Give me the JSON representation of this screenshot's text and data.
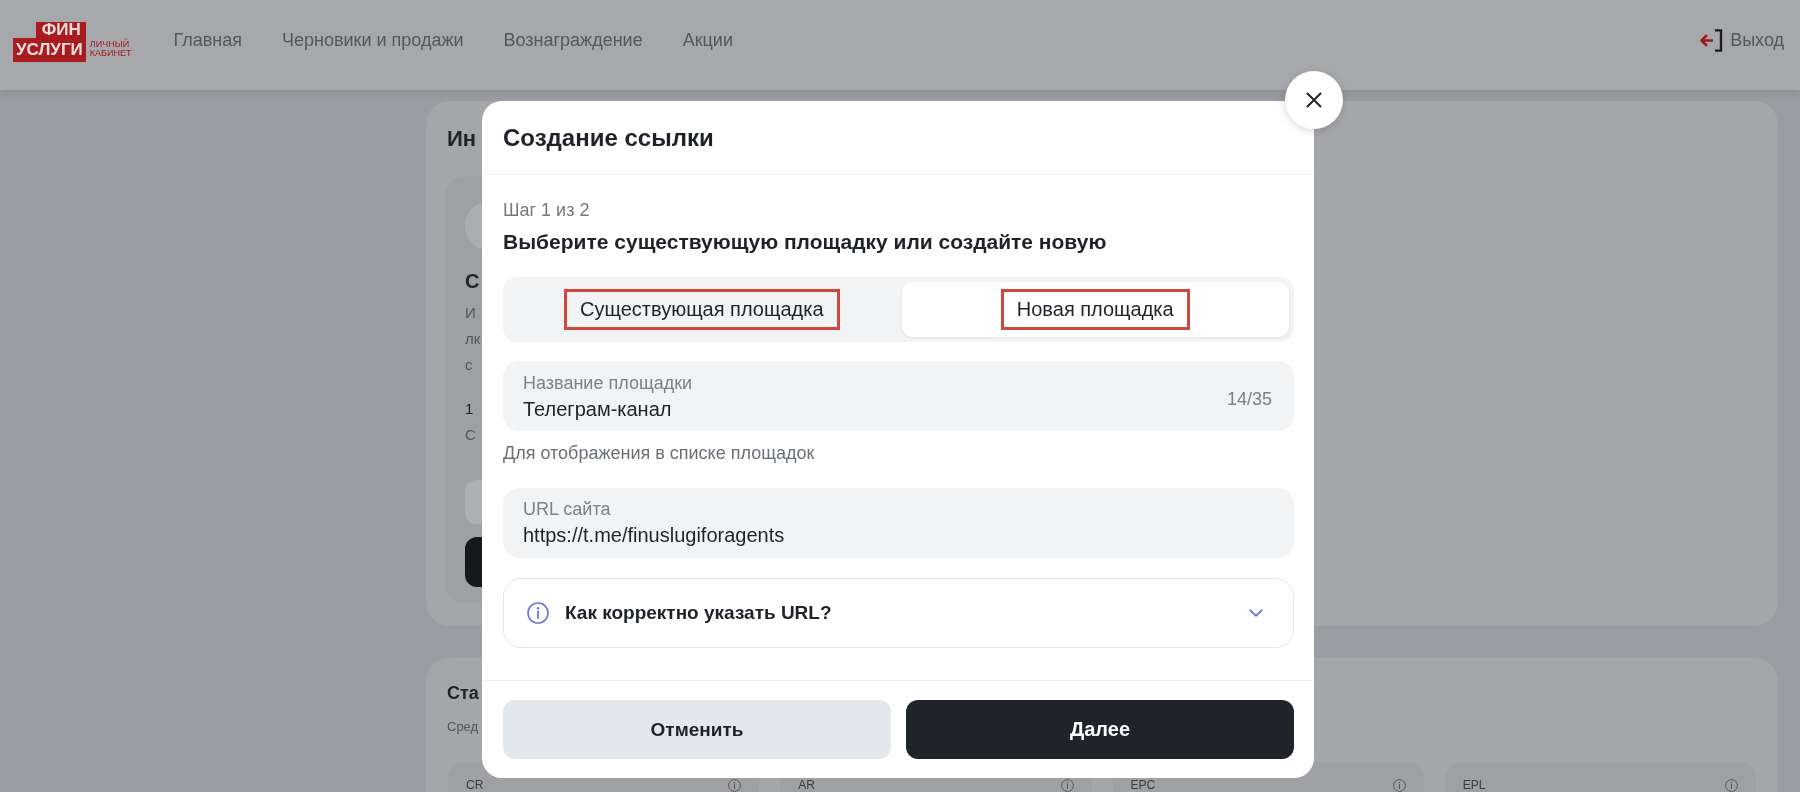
{
  "header": {
    "logo": {
      "top_word": "ФИН",
      "bottom_word": "УСЛУГИ",
      "caption": "ЛИЧНЫЙ КАБИНЕТ"
    },
    "nav": [
      "Главная",
      "Черновики и продажи",
      "Вознаграждение",
      "Акции"
    ],
    "logout": "Выход"
  },
  "page": {
    "info_card": {
      "title": "Ин",
      "subtitle": "С",
      "lines": [
        "И",
        "лк",
        "с"
      ],
      "count": "1",
      "count_caption": "С"
    },
    "stats_card": {
      "title": "Ста",
      "subtitle": "Сред",
      "metrics": [
        {
          "label": "CR"
        },
        {
          "label": "AR"
        },
        {
          "label": "EPC"
        },
        {
          "label": "EPL"
        }
      ]
    }
  },
  "dialog": {
    "title": "Создание ссылки",
    "step": "Шаг 1 из 2",
    "heading": "Выберите существующую площадку или создайте новую",
    "tabs": [
      {
        "label": "Существующая площадка",
        "selected": false,
        "highlighted": true
      },
      {
        "label": "Новая площадка",
        "selected": true,
        "highlighted": true
      }
    ],
    "fields": [
      {
        "label": "Название площадки",
        "value": "Телеграм-канал",
        "counter": "14/35",
        "hint": "Для отображения в списке площадок"
      },
      {
        "label": "URL сайта",
        "value": "https://t.me/finuslugiforagents"
      }
    ],
    "accordion": {
      "title": "Как корректно указать URL?",
      "expanded": false
    },
    "buttons": [
      {
        "label": "Отменить",
        "kind": "secondary"
      },
      {
        "label": "Далее",
        "kind": "primary"
      }
    ]
  }
}
